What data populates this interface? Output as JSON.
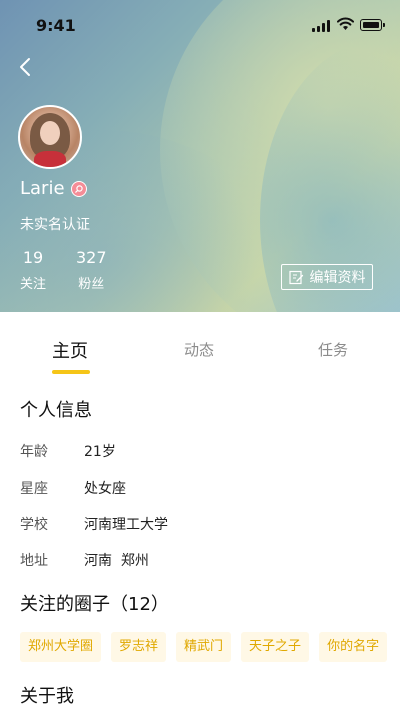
{
  "status_bar": {
    "time": "9:41"
  },
  "profile": {
    "username": "Larie",
    "verification": "未实名认证",
    "stats": [
      {
        "value": "19",
        "label": "关注"
      },
      {
        "value": "327",
        "label": "粉丝"
      }
    ],
    "edit_label": "编辑资料"
  },
  "tabs": [
    {
      "label": "主页",
      "active": true
    },
    {
      "label": "动态",
      "active": false
    },
    {
      "label": "任务",
      "active": false
    }
  ],
  "personal_info": {
    "title": "个人信息",
    "rows": [
      {
        "label": "年龄",
        "value": "21岁"
      },
      {
        "label": "星座",
        "value": "处女座"
      },
      {
        "label": "学校",
        "value": "河南理工大学"
      },
      {
        "label": "地址",
        "value": "河南  郑州"
      }
    ]
  },
  "circles": {
    "title": "关注的圈子（12）",
    "items": [
      "郑州大学圈",
      "罗志祥",
      "精武门",
      "天子之子",
      "你的名字"
    ]
  },
  "about": {
    "title": "关于我"
  },
  "colors": {
    "accent": "#f5c518",
    "chip_text": "#e0a800",
    "chip_bg": "#fff8e6",
    "badge": "#f48d97"
  },
  "icons": [
    "back-icon",
    "signal-icon",
    "wifi-icon",
    "battery-icon",
    "avatar",
    "search-badge-icon",
    "edit-icon"
  ]
}
